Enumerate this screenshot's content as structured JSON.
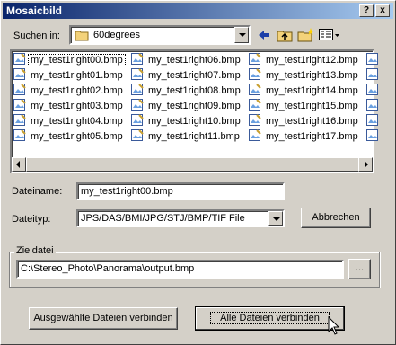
{
  "window": {
    "title": "Mosaicbild"
  },
  "titlebar": {
    "help_label": "?",
    "close_label": "x"
  },
  "lookin": {
    "label": "Suchen in:",
    "folder": "60degrees"
  },
  "files": [
    [
      "my_test1right00.bmp",
      "my_test1right01.bmp",
      "my_test1right02.bmp",
      "my_test1right03.bmp",
      "my_test1right04.bmp",
      "my_test1right05.bmp"
    ],
    [
      "my_test1right06.bmp",
      "my_test1right07.bmp",
      "my_test1right08.bmp",
      "my_test1right09.bmp",
      "my_test1right10.bmp",
      "my_test1right11.bmp"
    ],
    [
      "my_test1right12.bmp",
      "my_test1right13.bmp",
      "my_test1right14.bmp",
      "my_test1right15.bmp",
      "my_test1right16.bmp",
      "my_test1right17.bmp"
    ]
  ],
  "selected_file": "my_test1right00.bmp",
  "filename": {
    "label": "Dateiname:",
    "value": "my_test1right00.bmp"
  },
  "filetype": {
    "label": "Dateityp:",
    "value": "JPS/DAS/BMI/JPG/STJ/BMP/TIF File"
  },
  "cancel_label": "Abbrechen",
  "target": {
    "legend": "Zieldatei",
    "path": "C:\\Stereo_Photo\\Panorama\\output.bmp",
    "browse_label": "..."
  },
  "join_selected_label": "Ausgewählte Dateien verbinden",
  "join_all_label": "Alle Dateien verbinden"
}
